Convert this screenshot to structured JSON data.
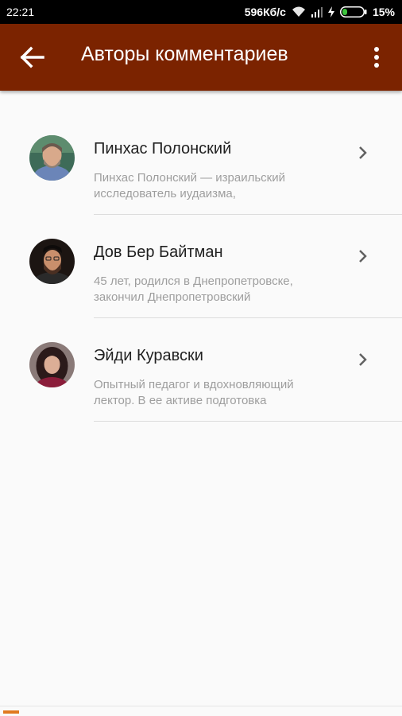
{
  "status_bar": {
    "time": "22:21",
    "network_speed": "596Кб/с",
    "battery_percent": "15%",
    "icons": [
      "wifi-icon",
      "signal-icon",
      "charging-icon",
      "battery-icon"
    ]
  },
  "app_bar": {
    "title": "Авторы комментариев",
    "back_icon": "arrow-left-icon",
    "menu_icon": "more-vertical-icon",
    "color": "#7b2300"
  },
  "authors": [
    {
      "name": "Пинхас Полонский",
      "desc_line1": "Пинхас Полонский — израильский",
      "desc_line2": "исследователь иудаизма,"
    },
    {
      "name": "Дов Бер Байтман",
      "desc_line1": "45 лет, родился в Днепропетровске,",
      "desc_line2": "закончил Днепропетровский"
    },
    {
      "name": "Эйди Куравски",
      "desc_line1": "Опытный педагог и вдохновляющий",
      "desc_line2": "лектор. В ее активе подготовка"
    }
  ]
}
